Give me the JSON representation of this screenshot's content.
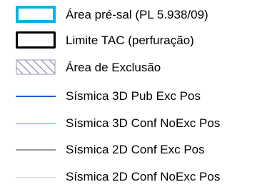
{
  "legend": {
    "items": [
      {
        "label": "Área pré-sal (PL 5.938/09)",
        "symbol": "outline-box",
        "color": "#00b4e6"
      },
      {
        "label": "Limite TAC (perfuração)",
        "symbol": "outline-box",
        "color": "#000000"
      },
      {
        "label": "Área de Exclusão",
        "symbol": "hatched-box",
        "color": "#8080a0"
      },
      {
        "label": "Sísmica 3D Pub Exc Pos",
        "symbol": "line",
        "color": "#1f5fd6"
      },
      {
        "label": "Sísmica 3D Conf NoExc Pos",
        "symbol": "line",
        "color": "#8fe0f5"
      },
      {
        "label": "Sísmica 2D Conf Exc Pos",
        "symbol": "line",
        "color": "#9a9a9a"
      },
      {
        "label": "Sísmica 2D Conf NoExc Pos",
        "symbol": "line",
        "color": "#d6d6d6"
      }
    ]
  }
}
